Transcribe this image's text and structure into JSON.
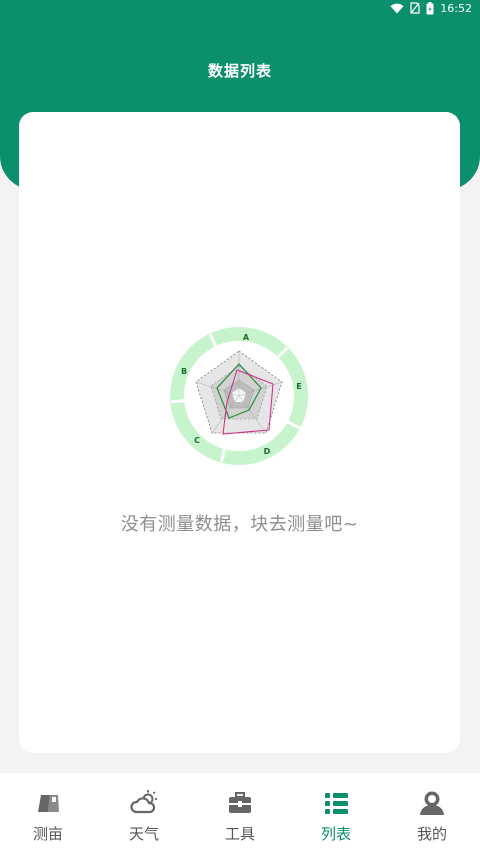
{
  "status_bar": {
    "time": "16:52"
  },
  "header": {
    "title": "数据列表"
  },
  "empty_state": {
    "message": "没有测量数据，块去测量吧~",
    "labels": [
      "A",
      "E",
      "D",
      "C",
      "B"
    ]
  },
  "tabs": [
    {
      "label": "测亩",
      "icon": "map-icon"
    },
    {
      "label": "天气",
      "icon": "weather-icon"
    },
    {
      "label": "工具",
      "icon": "toolbox-icon"
    },
    {
      "label": "列表",
      "icon": "list-icon",
      "active": true
    },
    {
      "label": "我的",
      "icon": "profile-icon"
    }
  ],
  "colors": {
    "brand": "#0c8f6c",
    "ring": "#c7f4cc",
    "inactive_icon": "#666666"
  }
}
